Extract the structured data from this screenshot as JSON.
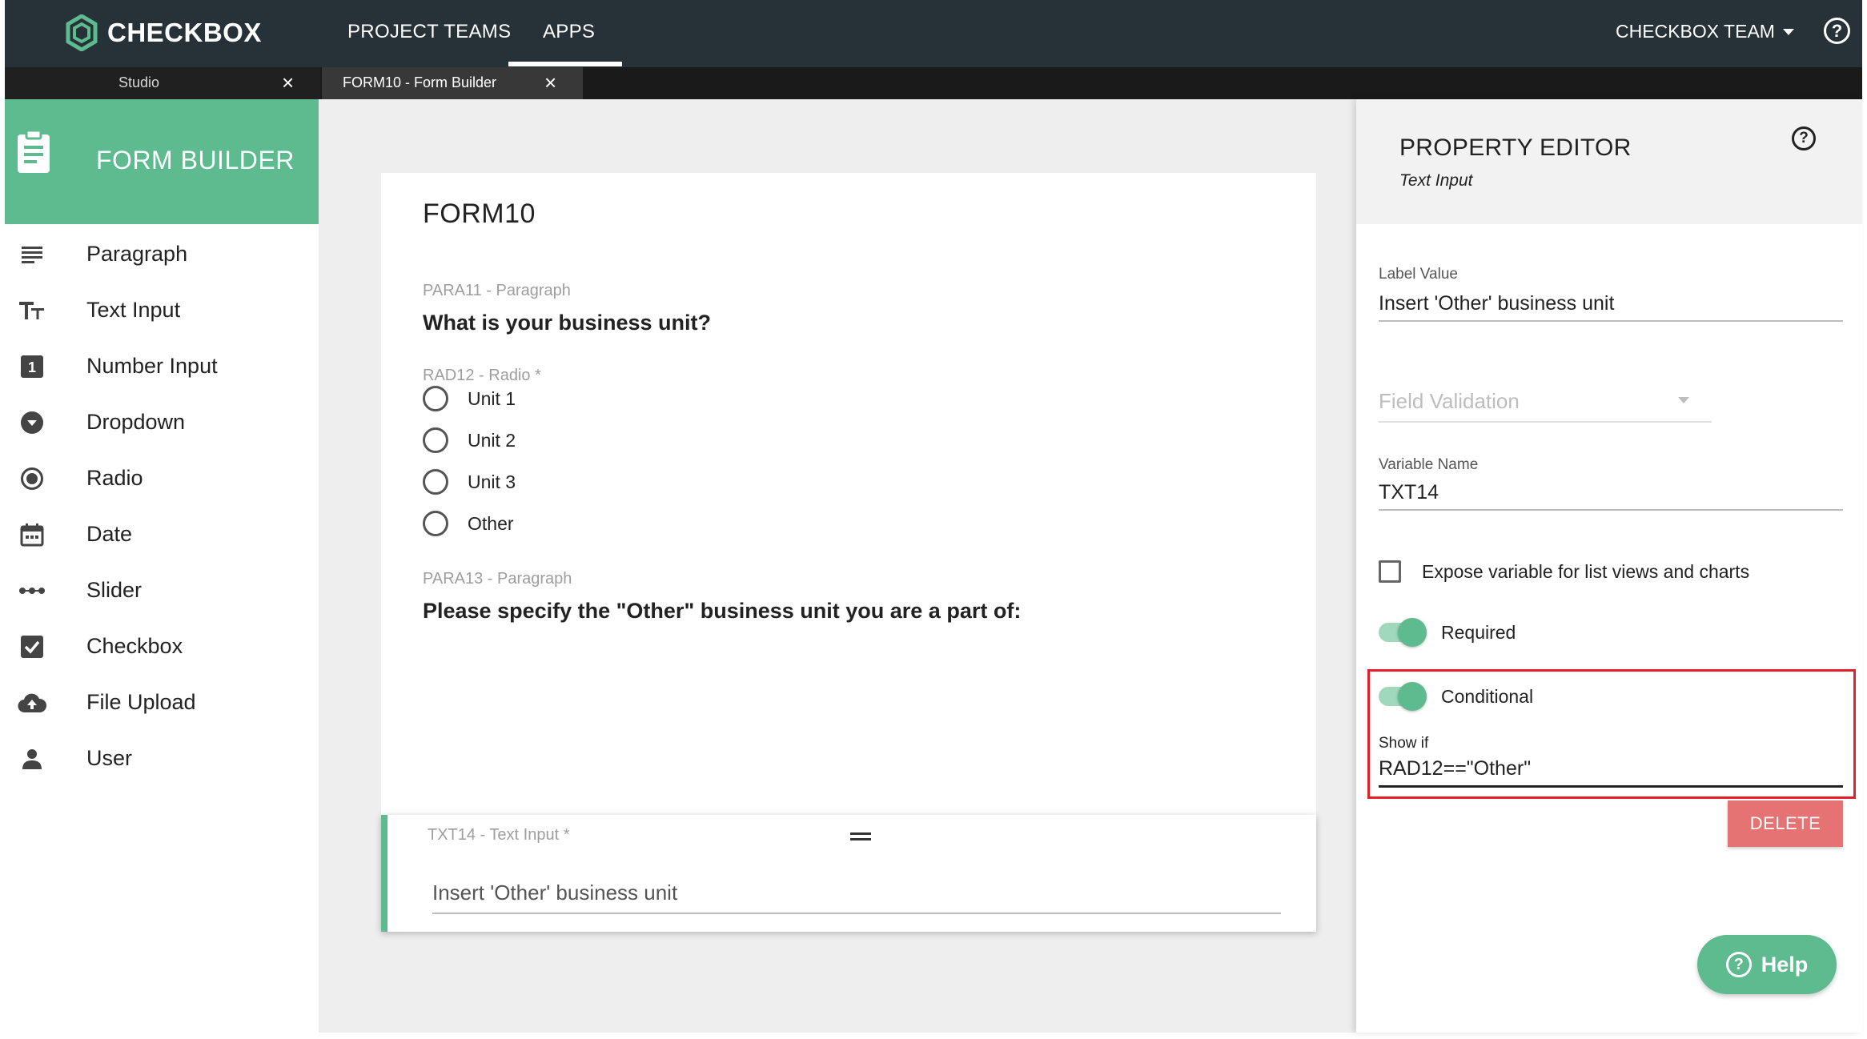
{
  "app": {
    "brand": "CHECKBOX",
    "nav": {
      "projects": "PROJECT TEAMS",
      "apps": "APPS",
      "team": "CHECKBOX TEAM",
      "help_glyph": "?"
    },
    "tabs": [
      {
        "label": "Studio",
        "close": "×"
      },
      {
        "label": "FORM10 - Form Builder",
        "close": "×"
      }
    ],
    "colors": {
      "brand_green": "#5dbb8f",
      "nav_dark": "#263238",
      "danger": "#e57373",
      "highlight_red": "#e0202a"
    }
  },
  "sidebar": {
    "title": "FORM BUILDER",
    "items": [
      {
        "label": "Paragraph",
        "icon": "paragraph-icon"
      },
      {
        "label": "Text Input",
        "icon": "text-input-icon"
      },
      {
        "label": "Number Input",
        "icon": "number-input-icon"
      },
      {
        "label": "Dropdown",
        "icon": "dropdown-icon"
      },
      {
        "label": "Radio",
        "icon": "radio-icon"
      },
      {
        "label": "Date",
        "icon": "calendar-icon"
      },
      {
        "label": "Slider",
        "icon": "slider-icon"
      },
      {
        "label": "Checkbox",
        "icon": "checkbox-icon"
      },
      {
        "label": "File Upload",
        "icon": "cloud-upload-icon"
      },
      {
        "label": "User",
        "icon": "user-icon"
      }
    ]
  },
  "form": {
    "title": "FORM10",
    "para11": {
      "caption": "PARA11 - Paragraph",
      "text": "What is your business unit?"
    },
    "rad12": {
      "caption": "RAD12 - Radio *",
      "options": [
        "Unit 1",
        "Unit 2",
        "Unit 3",
        "Other"
      ]
    },
    "para13": {
      "caption": "PARA13 - Paragraph",
      "text": "Please specify the \"Other\" business unit you are a part of:"
    },
    "txt14": {
      "caption": "TXT14 - Text Input *",
      "placeholder": "Insert 'Other' business unit"
    }
  },
  "property_editor": {
    "title": "PROPERTY EDITOR",
    "subtitle": "Text Input",
    "help_glyph": "?",
    "label_value": {
      "label": "Label Value",
      "value": "Insert 'Other' business unit"
    },
    "field_validation": {
      "placeholder": "Field Validation"
    },
    "variable_name": {
      "label": "Variable Name",
      "value": "TXT14"
    },
    "expose": {
      "label": "Expose variable for list views and charts",
      "checked": false
    },
    "required": {
      "label": "Required",
      "on": true
    },
    "conditional": {
      "label": "Conditional",
      "on": true
    },
    "show_if": {
      "label": "Show if",
      "value": "RAD12==\"Other\""
    },
    "delete_label": "DELETE",
    "help_fab": {
      "label": "Help",
      "glyph": "?"
    }
  }
}
